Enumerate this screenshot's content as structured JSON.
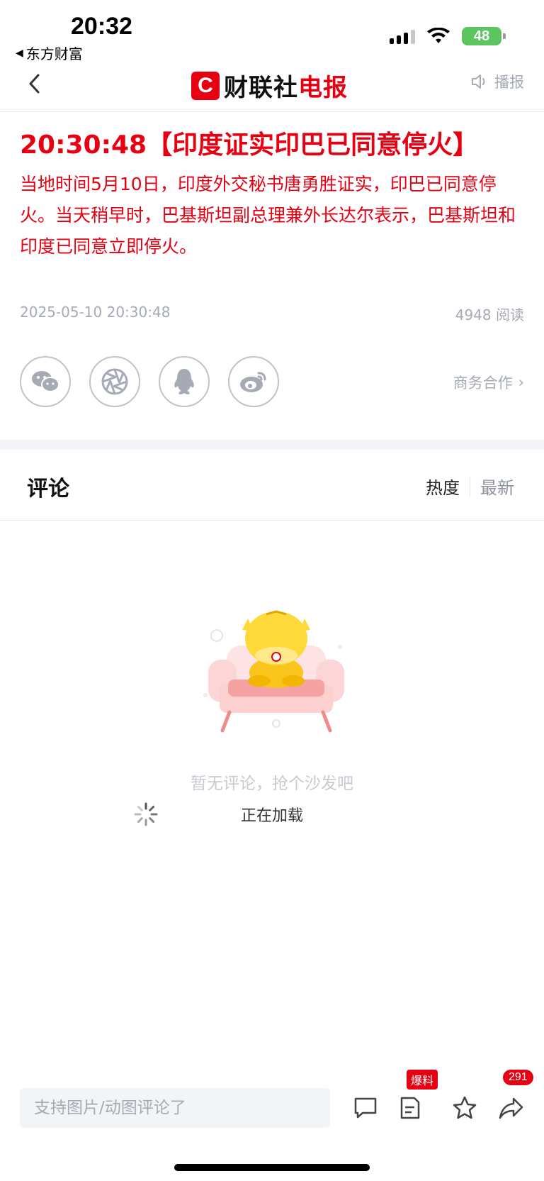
{
  "status_bar": {
    "time": "20:32",
    "back_app": "东方财富",
    "battery": "48"
  },
  "nav": {
    "brand_logo_letter": "C",
    "brand_name_black": "财联社",
    "brand_name_red": "电报",
    "broadcast_label": "播报"
  },
  "article": {
    "title": "20:30:48【印度证实印巴已同意停火】",
    "body": "当地时间5月10日，印度外交秘书唐勇胜证实，印巴已同意停火。当天稍早时，巴基斯坦副总理兼外长达尔表示，巴基斯坦和印度已同意立即停火。",
    "datetime": "2025-05-10 20:30:48",
    "reads": "4948 阅读"
  },
  "share": {
    "icons": [
      "wechat-icon",
      "moments-icon",
      "qq-icon",
      "weibo-icon"
    ],
    "business_label": "商务合作"
  },
  "comments": {
    "title": "评论",
    "sort_hot": "热度",
    "sort_new": "最新",
    "empty_text": "暂无评论，抢个沙发吧",
    "loading_text": "正在加载"
  },
  "bottom_bar": {
    "input_placeholder": "支持图片/动图评论了",
    "tip_badge": "爆料",
    "share_count": "291"
  },
  "colors": {
    "accent_red": "#e60012",
    "muted_gray": "#a5aab5",
    "battery_green": "#5cc55f"
  }
}
